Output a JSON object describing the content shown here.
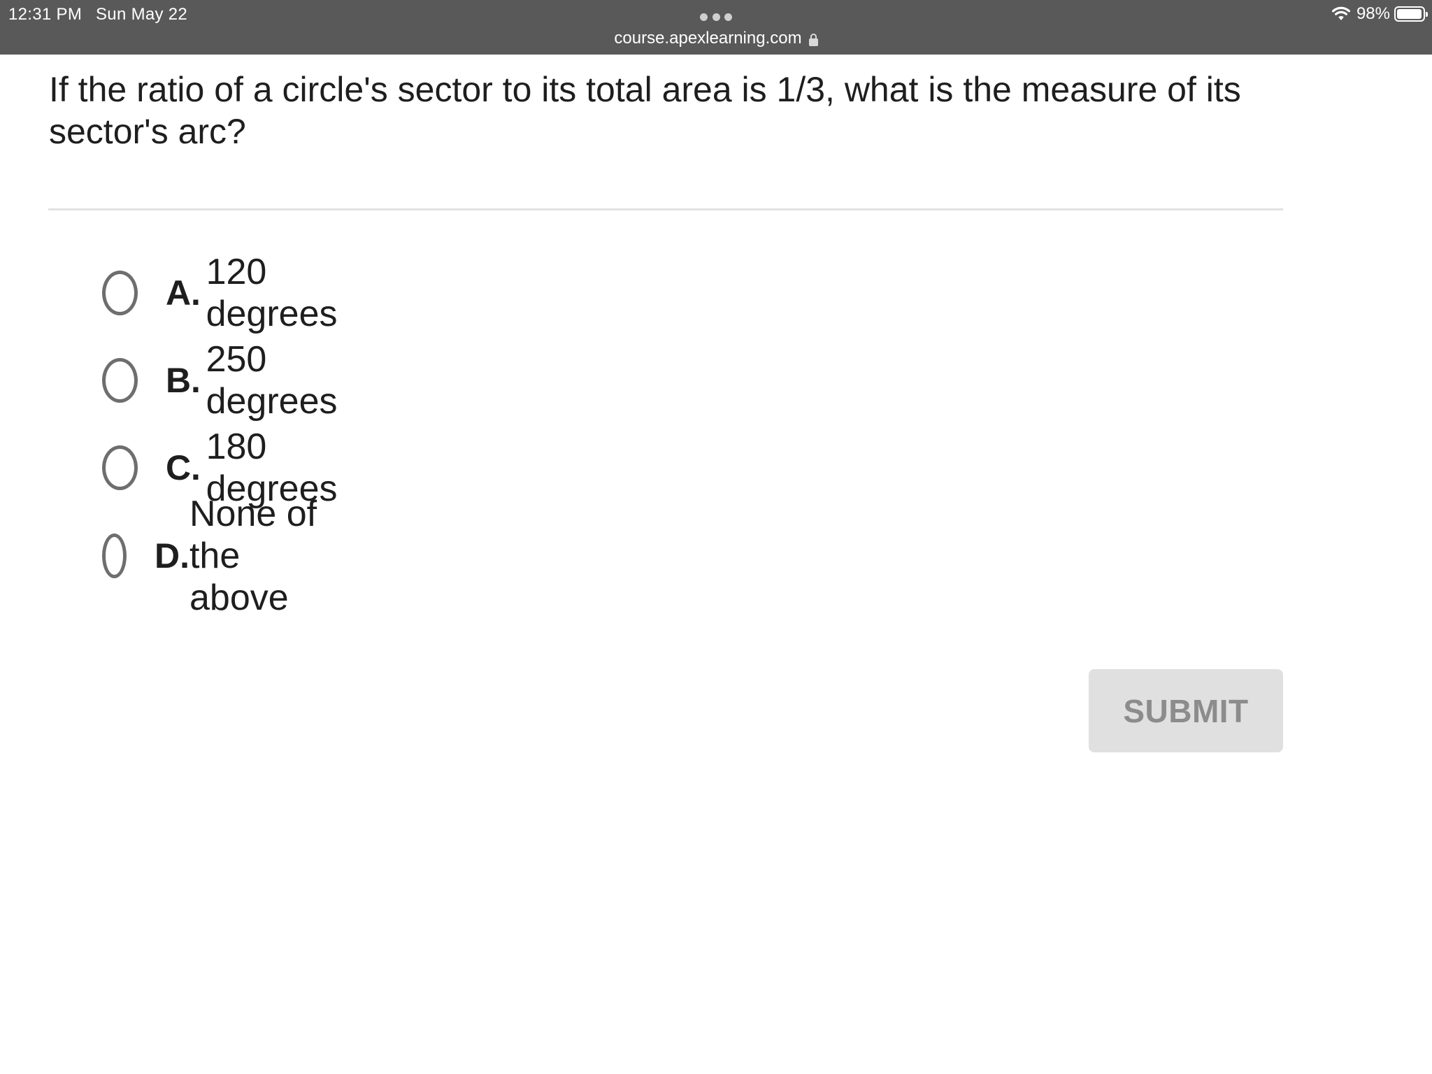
{
  "status_bar": {
    "time": "12:31 PM",
    "date": "Sun May 22",
    "battery": "98%",
    "battery_level": 0.98
  },
  "browser": {
    "url": "course.apexlearning.com"
  },
  "question": {
    "text": "If the ratio of a circle's sector to its total area is 1/3, what is the measure of its sector's arc?"
  },
  "options": [
    {
      "letter": "A.",
      "text": "120 degrees",
      "selected": false
    },
    {
      "letter": "B.",
      "text": "250 degrees",
      "selected": false
    },
    {
      "letter": "C.",
      "text": "180 degrees",
      "selected": false
    },
    {
      "letter": "D.",
      "text": "None of the above",
      "selected": false
    }
  ],
  "submit": {
    "label": "SUBMIT",
    "enabled": false
  },
  "colors": {
    "status_bar_bg": "#595959",
    "radio_border": "#6e6e6e",
    "submit_bg_disabled": "#e0e0e0",
    "submit_text_disabled": "#8c8c8c"
  }
}
